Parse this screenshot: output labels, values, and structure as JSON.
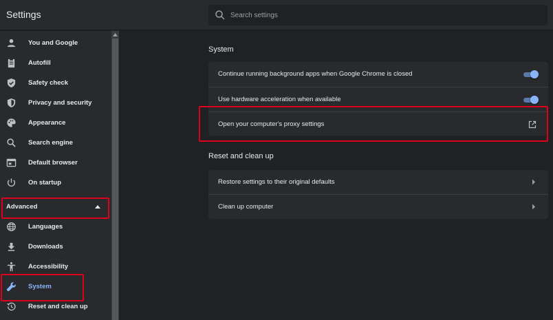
{
  "app": {
    "title": "Settings"
  },
  "search": {
    "placeholder": "Search settings"
  },
  "sidebar": {
    "items": [
      {
        "label": "You and Google"
      },
      {
        "label": "Autofill"
      },
      {
        "label": "Safety check"
      },
      {
        "label": "Privacy and security"
      },
      {
        "label": "Appearance"
      },
      {
        "label": "Search engine"
      },
      {
        "label": "Default browser"
      },
      {
        "label": "On startup"
      }
    ],
    "advanced": {
      "label": "Advanced"
    },
    "advanced_items": [
      {
        "label": "Languages"
      },
      {
        "label": "Downloads"
      },
      {
        "label": "Accessibility"
      },
      {
        "label": "System",
        "active": true
      },
      {
        "label": "Reset and clean up"
      }
    ]
  },
  "system": {
    "title": "System",
    "rows": [
      {
        "label": "Continue running background apps when Google Chrome is closed",
        "toggle": true
      },
      {
        "label": "Use hardware acceleration when available",
        "toggle": true
      },
      {
        "label": "Open your computer's proxy settings",
        "icon": "external-link-icon"
      }
    ]
  },
  "reset": {
    "title": "Reset and clean up",
    "rows": [
      {
        "label": "Restore settings to their original defaults",
        "icon": "chevron-right-icon"
      },
      {
        "label": "Clean up computer",
        "icon": "chevron-right-icon"
      }
    ]
  },
  "colors": {
    "accent": "#8ab4f8",
    "highlight": "#e0001b",
    "background": "#202124",
    "surface": "#292a2d"
  }
}
